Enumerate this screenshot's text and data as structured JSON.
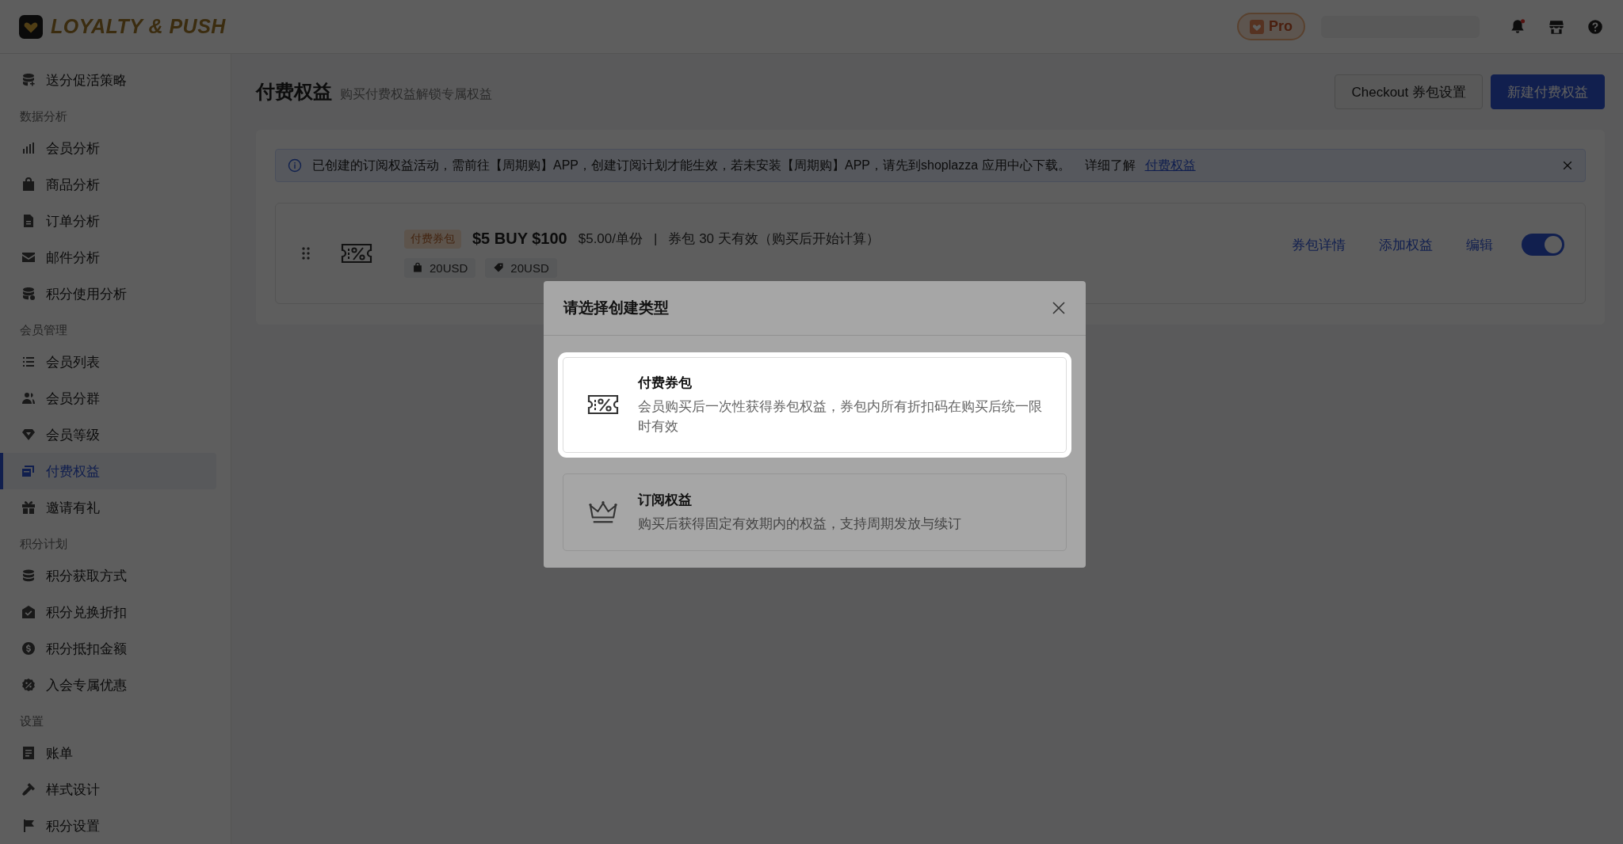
{
  "header": {
    "logo_text": "LOYALTY & PUSH",
    "plan_badge": "Pro"
  },
  "sidebar": {
    "items": [
      {
        "kind": "item",
        "label": "送分促活策略",
        "selected": false
      },
      {
        "kind": "heading",
        "label": "数据分析"
      },
      {
        "kind": "item",
        "label": "会员分析",
        "selected": false
      },
      {
        "kind": "item",
        "label": "商品分析",
        "selected": false
      },
      {
        "kind": "item",
        "label": "订单分析",
        "selected": false
      },
      {
        "kind": "item",
        "label": "邮件分析",
        "selected": false
      },
      {
        "kind": "item",
        "label": "积分使用分析",
        "selected": false
      },
      {
        "kind": "heading",
        "label": "会员管理"
      },
      {
        "kind": "item",
        "label": "会员列表",
        "selected": false
      },
      {
        "kind": "item",
        "label": "会员分群",
        "selected": false
      },
      {
        "kind": "item",
        "label": "会员等级",
        "selected": false
      },
      {
        "kind": "item",
        "label": "付费权益",
        "selected": true
      },
      {
        "kind": "item",
        "label": "邀请有礼",
        "selected": false
      },
      {
        "kind": "heading",
        "label": "积分计划"
      },
      {
        "kind": "item",
        "label": "积分获取方式",
        "selected": false
      },
      {
        "kind": "item",
        "label": "积分兑换折扣",
        "selected": false
      },
      {
        "kind": "item",
        "label": "积分抵扣金额",
        "selected": false
      },
      {
        "kind": "item",
        "label": "入会专属优惠",
        "selected": false
      },
      {
        "kind": "heading",
        "label": "设置"
      },
      {
        "kind": "item",
        "label": "账单",
        "selected": false
      },
      {
        "kind": "item",
        "label": "样式设计",
        "selected": false
      },
      {
        "kind": "item",
        "label": "积分设置",
        "selected": false
      }
    ]
  },
  "page": {
    "title": "付费权益",
    "subtitle": "购买付费权益解锁专属权益",
    "buttons": [
      {
        "label": "Checkout 券包设置",
        "kind": "secondary"
      },
      {
        "label": "新建付费权益",
        "kind": "primary"
      }
    ]
  },
  "alert": {
    "text": "已创建的订阅权益活动，需前往【周期购】APP，创建订阅计划才能生效，若未安装【周期购】APP，请先到shoplazza 应用中心下载。",
    "learn_more": "详细了解",
    "link": "付费权益"
  },
  "benefits": [
    {
      "tag": "付费券包",
      "name": "$5 BUY $100",
      "price": "$5.00/单份",
      "separator": "|",
      "validity": "券包 30 天有效（购买后开始计算）",
      "chips": [
        "20USD",
        "20USD"
      ],
      "actions": [
        "券包详情",
        "添加权益",
        "编辑"
      ],
      "on": true
    }
  ],
  "modal": {
    "title": "请选择创建类型",
    "options": [
      {
        "title": "付费券包",
        "description": "会员购买后一次性获得券包权益，券包内所有折扣码在购买后统一限时有效",
        "selected": true
      },
      {
        "title": "订阅权益",
        "description": "购买后获得固定有效期内的权益，支持周期发放与续订",
        "selected": false
      }
    ]
  }
}
